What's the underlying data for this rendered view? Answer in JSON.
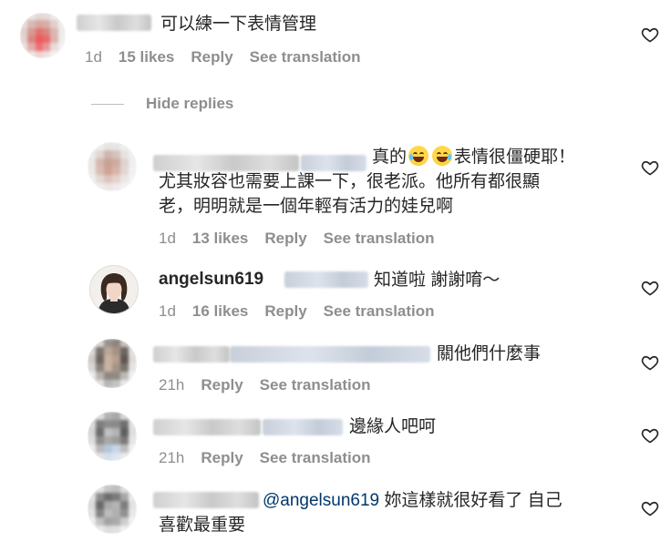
{
  "comments": [
    {
      "text": "可以練一下表情管理",
      "time": "1d",
      "likes": "15 likes",
      "reply": "Reply",
      "translate": "See translation"
    },
    {
      "text_line1_a": "真的",
      "text_line1_b": "表情很僵硬耶！",
      "text_line2": "尤其妝容也需要上課一下，很老派。他所有都很顯",
      "text_line3": "老，明明就是一個年輕有活力的娃兒啊",
      "emoji": "face-with-tears-of-joy-icon",
      "time": "1d",
      "likes": "13 likes",
      "reply": "Reply",
      "translate": "See translation"
    },
    {
      "username": "angelsun619",
      "text": "知道啦 謝謝唷～",
      "time": "1d",
      "likes": "16 likes",
      "reply": "Reply",
      "translate": "See translation"
    },
    {
      "text": "關他們什麼事",
      "time": "21h",
      "reply": "Reply",
      "translate": "See translation"
    },
    {
      "text": "邊緣人吧呵",
      "time": "21h",
      "reply": "Reply",
      "translate": "See translation"
    },
    {
      "mention": "@angelsun619",
      "text_line1": "妳這樣就很好看了 自己",
      "text_line2": "喜歡最重要"
    }
  ],
  "hide_replies": "Hide replies",
  "colors": {
    "text": "#262626",
    "secondary": "#8e8e8e",
    "mention": "#00376b"
  }
}
